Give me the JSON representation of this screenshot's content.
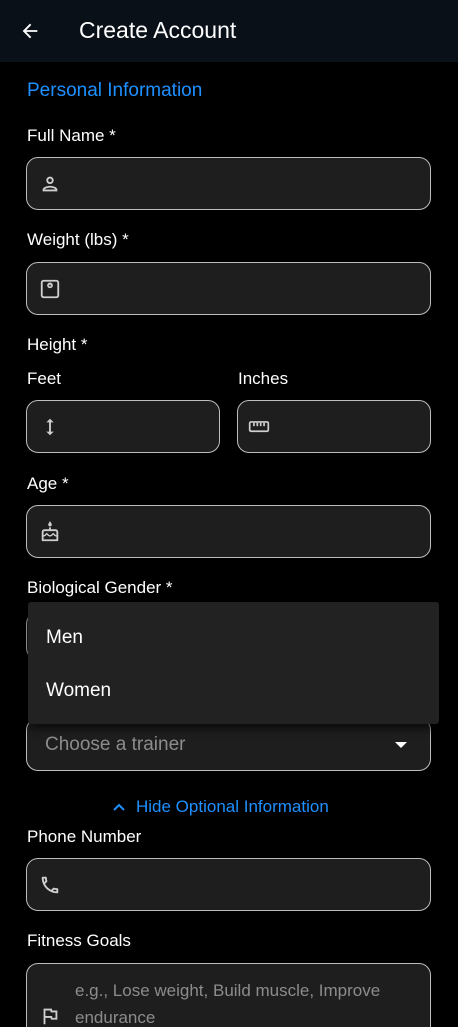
{
  "header": {
    "title": "Create Account"
  },
  "section": {
    "personal": "Personal Information"
  },
  "fields": {
    "full_name": {
      "label": "Full Name *",
      "value": ""
    },
    "weight": {
      "label": "Weight (lbs) *",
      "value": ""
    },
    "height": {
      "label": "Height *",
      "feet_label": "Feet",
      "inches_label": "Inches"
    },
    "age": {
      "label": "Age *",
      "value": ""
    },
    "gender": {
      "label": "Biological Gender *",
      "options": [
        "Men",
        "Women"
      ]
    },
    "trainer": {
      "placeholder": "Choose a trainer"
    },
    "phone": {
      "label": "Phone Number",
      "value": ""
    },
    "goals": {
      "label": "Fitness Goals",
      "placeholder": "e.g., Lose weight, Build muscle, Improve endurance"
    }
  },
  "optional_toggle": {
    "label": "Hide Optional Information"
  },
  "colors": {
    "accent": "#1e90ff",
    "background": "#000000",
    "field_bg": "#1e1e1e",
    "appbar_bg": "#0a1018"
  },
  "icons": [
    "arrow-back-icon",
    "person-icon",
    "scale-icon",
    "vertical-arrows-icon",
    "ruler-icon",
    "cake-icon",
    "dropdown-arrow-icon",
    "chevron-up-icon",
    "phone-icon",
    "flag-icon"
  ]
}
